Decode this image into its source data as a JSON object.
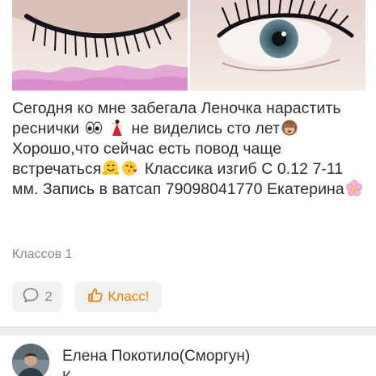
{
  "post": {
    "text_segments": [
      "Сегодня ко мне забегала Леночка нарастить реснички ",
      " ",
      " не виделись сто лет",
      " Хорошо,что сейчас есть повод чаще встречаться",
      "",
      " Классика изгиб С 0.12 7-11 мм. Запись в ватсап 79098041770 Екатерина",
      ""
    ],
    "emoji": [
      "eyes-emoji",
      "dancer-emoji",
      "see-no-evil-monkey-emoji",
      "hugging-face-emoji",
      "kissing-heart-emoji",
      "cherry-blossom-emoji"
    ],
    "classes_label": "Классов 1"
  },
  "actions": {
    "comments_count": "2",
    "class_label": "Класс!"
  },
  "next_comment": {
    "author": "Елена Покотило(Сморгун)",
    "snippet": "К"
  },
  "colors": {
    "text": "#2c2d2e",
    "muted": "#8a8a8e",
    "button_bg": "#f2f2f4",
    "accent": "#ee8208",
    "divider": "#ededf0"
  }
}
